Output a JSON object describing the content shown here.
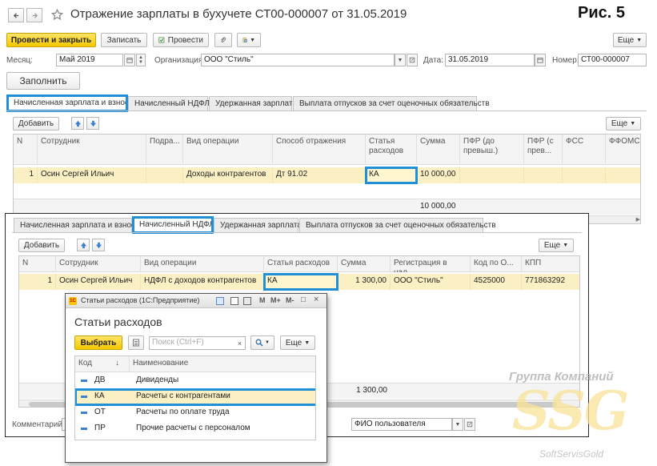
{
  "doc": {
    "title": "Отражение зарплаты в бухучете СТ00-000007 от 31.05.2019",
    "figure_label": "Рис. 5",
    "toolbar": {
      "post_close": "Провести и закрыть",
      "save": "Записать",
      "post": "Провести",
      "more": "Еще"
    },
    "fields": {
      "month_label": "Месяц:",
      "month_value": "Май 2019",
      "org_label": "Организация:",
      "org_value": "ООО \"Стиль\"",
      "date_label": "Дата:",
      "date_value": "31.05.2019",
      "number_label": "Номер:",
      "number_value": "СТ00-000007"
    },
    "fill_button": "Заполнить",
    "tabs": [
      "Начисленная зарплата и взносы",
      "Начисленный НДФЛ",
      "Удержанная зарплата",
      "Выплата отпусков за счет оценочных обязательств"
    ],
    "table_toolbar": {
      "add": "Добавить",
      "more": "Еще"
    },
    "grid1": {
      "columns": [
        "N",
        "Сотрудник",
        "Подра...",
        "Вид операции",
        "Способ отражения",
        "Статья расходов",
        "Сумма",
        "ПФР (до превыш.)",
        "ПФР (с прев...",
        "ФСС",
        "ФФОМС"
      ],
      "row": [
        "1",
        "Осин Сергей Ильич",
        "",
        "Доходы контрагентов",
        "Дт 91.02",
        "КА",
        "10 000,00",
        "",
        "",
        "",
        ""
      ],
      "total": "10 000,00"
    }
  },
  "overlay": {
    "tabs": [
      "Начисленная зарплата и взносы",
      "Начисленный НДФЛ",
      "Удержанная зарплата",
      "Выплата отпусков за счет оценочных обязательств"
    ],
    "table_toolbar": {
      "add": "Добавить",
      "more": "Еще"
    },
    "grid2": {
      "columns": [
        "N",
        "Сотрудник",
        "Вид операции",
        "Статья расходов",
        "Сумма",
        "Регистрация в нал...",
        "Код по О...",
        "КПП"
      ],
      "row": [
        "1",
        "Осин Сергей Ильич",
        "НДФЛ с доходов контрагентов",
        "КА",
        "1 300,00",
        "ООО \"Стиль\"",
        "4525000",
        "771863292"
      ],
      "total": "1 300,00"
    },
    "comment_label": "Комментарий:",
    "responsible_value": "ФИО пользователя"
  },
  "dialog": {
    "window_title": "Статьи расходов (1С:Предприятие)",
    "window_buttons": [
      "M",
      "M+",
      "M-"
    ],
    "heading": "Статьи расходов",
    "choose": "Выбрать",
    "search_placeholder": "Поиск (Ctrl+F)",
    "more": "Еще",
    "col_code": "Код",
    "col_sort": "↓",
    "col_name": "Наименование",
    "rows": [
      {
        "code": "ДВ",
        "name": "Дивиденды"
      },
      {
        "code": "КА",
        "name": "Расчеты с контрагентами"
      },
      {
        "code": "ОТ",
        "name": "Расчеты по оплате труда"
      },
      {
        "code": "ПР",
        "name": "Прочие расчеты с персоналом"
      }
    ]
  },
  "watermark": {
    "line1": "Группа Компаний",
    "big": "SSG",
    "line2": "SoftServisGold"
  },
  "colors": {
    "highlight": "#1f8fd6",
    "selected_row": "#fbf0c4",
    "primary_button": "#f5c800"
  }
}
